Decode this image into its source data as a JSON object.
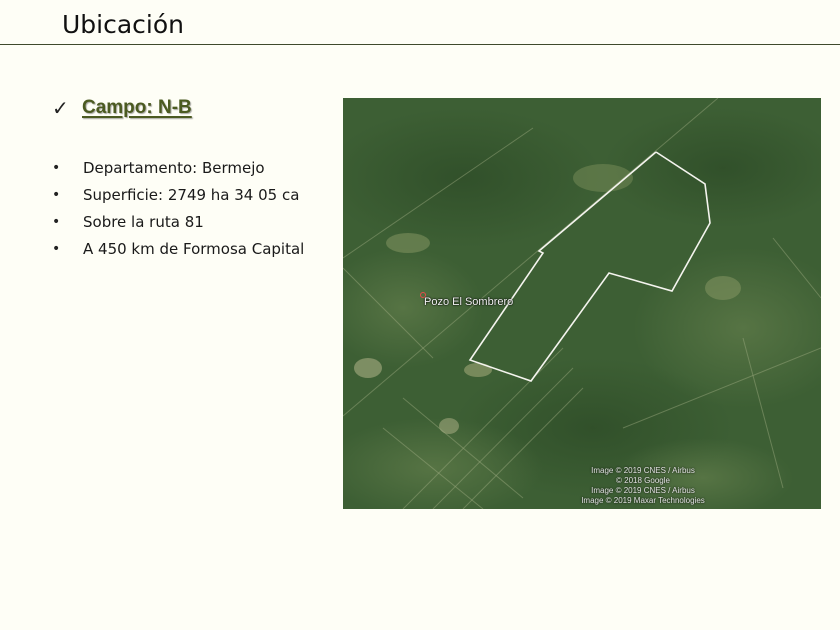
{
  "slide": {
    "title": "Ubicación",
    "heading": "Campo: N-B",
    "heading_icon": "check-icon",
    "bullets": [
      "Departamento: Bermejo",
      "Superficie: 2749 ha 34 05 ca",
      "Sobre la ruta 81",
      "A 450 km de Formosa Capital"
    ]
  },
  "map": {
    "place_label": "Pozo El Sombrero",
    "attribution": [
      "Image © 2019 CNES / Airbus",
      "© 2018 Google",
      "Image © 2019 CNES / Airbus",
      "Image © 2019 Maxar Technologies"
    ]
  },
  "colors": {
    "accent": "#4b5a21",
    "rule": "#3f4a2c",
    "map_base": "#3f6236"
  }
}
